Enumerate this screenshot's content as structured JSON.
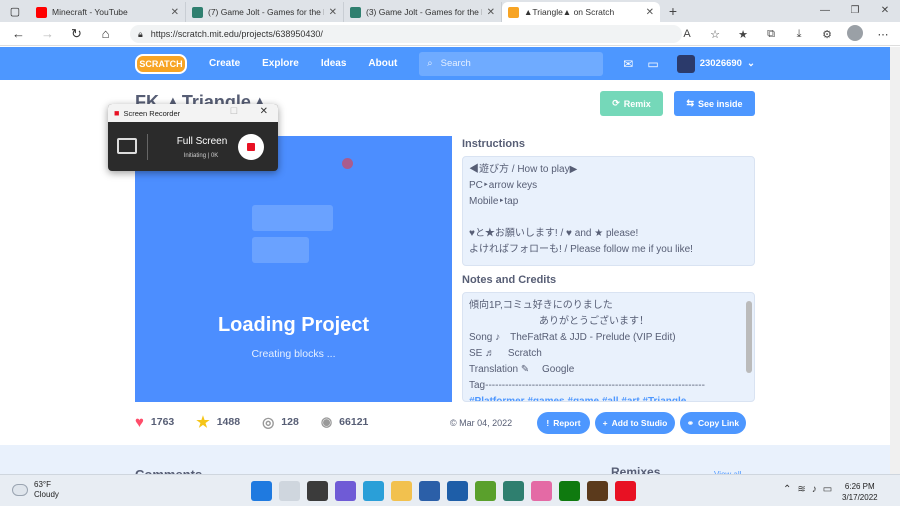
{
  "browser": {
    "tabs": [
      {
        "title": "Minecraft - YouTube",
        "icon_color": "#ff0000",
        "active": false
      },
      {
        "title": "(7) Game Jolt - Games for the lo",
        "icon_color": "#2f7f6f",
        "active": false
      },
      {
        "title": "(3) Game Jolt - Games for the lo",
        "icon_color": "#2f7f6f",
        "active": false
      },
      {
        "title": "▲Triangle▲ on Scratch",
        "icon_color": "#f7a424",
        "active": true
      }
    ],
    "url": "https://scratch.mit.edu/projects/638950430/"
  },
  "scratch": {
    "logo_text": "SCRATCH",
    "nav": [
      "Create",
      "Explore",
      "Ideas",
      "About"
    ],
    "search_placeholder": "Search",
    "username": "23026690"
  },
  "project": {
    "title_prefix": "FK",
    "title": "▲Triangle▲",
    "remix_label": "Remix",
    "see_inside_label": "See inside",
    "loading_title": "Loading Project",
    "loading_sub": "Creating blocks ...",
    "instructions_heading": "Instructions",
    "instructions": [
      "◀遊び方 / How to play▶",
      "PC‣arrow keys",
      "Mobile‣tap",
      "",
      "♥と★お願いします! / ♥ and ★ please!",
      "よければフォローも! / Please follow me if you like!"
    ],
    "notes_heading": "Notes and Credits",
    "notes": [
      "傾向1P,コミュ好きにのりました",
      "　　　　　　　ありがとうございます！",
      "Song ♪　TheFatRat & JJD - Prelude (VIP Edit)",
      "SE ♬　 Scratch",
      "Translation ✎　 Google",
      "Tag------------------------------------------------------------------"
    ],
    "tags_line": "#Platformer  #games  #game  #all  #art  #Triangle",
    "loves": "1763",
    "favorites": "1488",
    "remixes": "128",
    "views": "66121",
    "date": "Mar 04, 2022",
    "report_label": "Report",
    "add_to_studio_label": "Add to Studio",
    "copy_link_label": "Copy Link",
    "comments_heading": "Comments",
    "remixes_heading": "Remixes",
    "view_all": "View all"
  },
  "recorder": {
    "title": "Screen Recorder",
    "mode": "Full Screen",
    "status": "Initiating",
    "size": "0K"
  },
  "taskbar": {
    "temp": "63°F",
    "weather": "Cloudy",
    "time": "6:26 PM",
    "date": "3/17/2022"
  }
}
